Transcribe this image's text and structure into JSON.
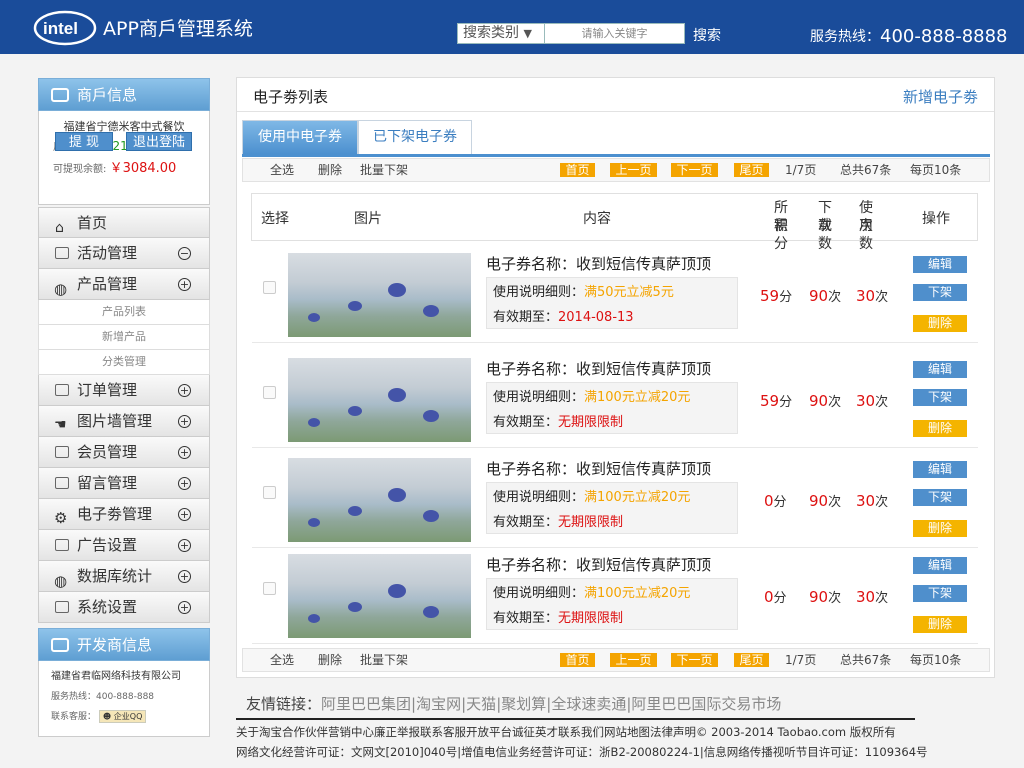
{
  "header": {
    "logo_text": "intel",
    "app_title": "APP商戶管理系统",
    "search_category": "搜索类别",
    "search_placeholder": "请输入关键字",
    "search_button": "搜索",
    "hotline_label": "服务热线：",
    "hotline_number": "400-888-8888"
  },
  "merchant": {
    "heading": "商戶信息",
    "shop_name": "福建省宁德米客中式餐饮",
    "user_label": "用户名:",
    "user_value": "80521015",
    "balance_label": "可提现余额:",
    "balance_value": "￥3084.00",
    "withdraw_button": "提 现",
    "logout_button": "退出登陆"
  },
  "menu": {
    "home": "首页",
    "activity": "活动管理",
    "product": "产品管理",
    "product_list": "产品列表",
    "product_add": "新增产品",
    "product_category": "分类管理",
    "order": "订单管理",
    "gallery": "图片墙管理",
    "member": "会员管理",
    "message": "留言管理",
    "coupon": "电子劵管理",
    "ad": "广告设置",
    "stats": "数据库统计",
    "settings": "系统设置"
  },
  "developer": {
    "heading": "开发商信息",
    "company": "福建省君临网络科技有限公司",
    "hotline": "服务热线：400-888-888",
    "support_label": "联系客服：",
    "qq_label": "企业QQ"
  },
  "main": {
    "title": "电子劵列表",
    "add_button": "新增电子劵",
    "tab_active": "使用中电子券",
    "tab_inactive": "已下架电子券",
    "toolbar": {
      "select_all": "全选",
      "delete": "删除",
      "batch_off": "批量下架",
      "first": "首页",
      "prev": "上一页",
      "next": "下一页",
      "last": "尾页",
      "page_info": "1/7页",
      "total": "总共67条",
      "per_page": "每页10条"
    },
    "columns": {
      "select": "选择",
      "image": "图片",
      "content": "内容",
      "points_1": "所需",
      "points_2": "积分",
      "downloads_1": "下载",
      "downloads_2": "次数",
      "uses_1": "使用",
      "uses_2": "次数",
      "action": "操作"
    },
    "actions": {
      "edit": "编辑",
      "off": "下架",
      "delete": "删除"
    },
    "units": {
      "points": "分",
      "times": "次"
    },
    "coupons": [
      {
        "name": "电子券名称：收到短信传真萨顶顶",
        "rule_label": "使用说明细则：",
        "rule": "满50元立减5元",
        "expiry_label": "有效期至：",
        "expiry": "2014-08-13",
        "points": "59",
        "downloads": "90",
        "uses": "30"
      },
      {
        "name": "电子券名称：收到短信传真萨顶顶",
        "rule_label": "使用说明细则：",
        "rule": "满100元立减20元",
        "expiry_label": "有效期至：",
        "expiry": "无期限限制",
        "points": "59",
        "downloads": "90",
        "uses": "30"
      },
      {
        "name": "电子券名称：收到短信传真萨顶顶",
        "rule_label": "使用说明细则：",
        "rule": "满100元立减20元",
        "expiry_label": "有效期至：",
        "expiry": "无期限限制",
        "points": "0",
        "downloads": "90",
        "uses": "30"
      },
      {
        "name": "电子券名称：收到短信传真萨顶顶",
        "rule_label": "使用说明细则：",
        "rule": "满100元立减20元",
        "expiry_label": "有效期至：",
        "expiry": "无期限限制",
        "points": "0",
        "downloads": "90",
        "uses": "30"
      }
    ]
  },
  "footer": {
    "friend_label": "友情链接：",
    "links": [
      "阿里巴巴集团",
      "淘宝网",
      "天猫",
      "聚划算",
      "全球速卖通",
      "阿里巴巴国际交易市场"
    ],
    "line1": "关于淘宝合作伙伴营销中心廉正举报联系客服开放平台诚征英才联系我们网站地图法律声明© 2003-2014 Taobao.com 版权所有",
    "line2": "网络文化经营许可证：文网文[2010]040号|增值电信业务经营许可证：浙B2-20080224-1|信息网络传播视听节目许可证：1109364号"
  },
  "colors": {
    "header_bg": "#1a4c9a",
    "accent_blue": "#4f8fcc",
    "accent_orange": "#f4a400",
    "price_red": "#dd1111"
  }
}
